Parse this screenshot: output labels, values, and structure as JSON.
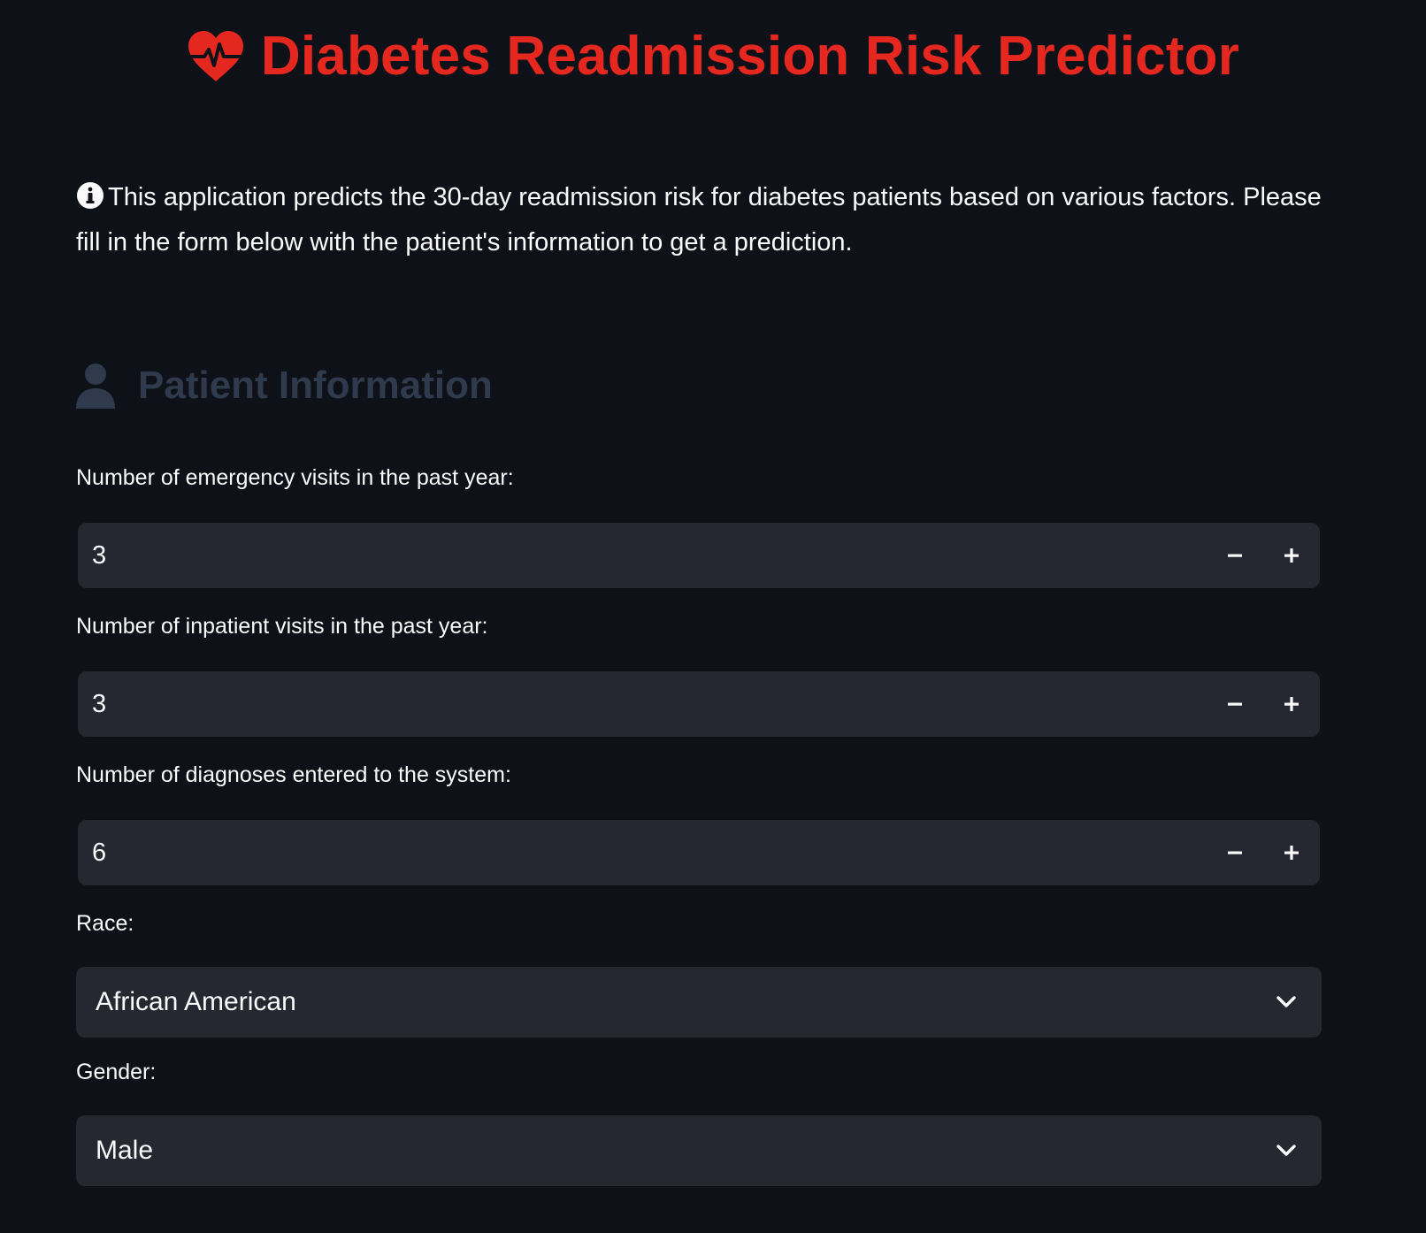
{
  "header": {
    "title": "Diabetes Readmission Risk Predictor",
    "icon": "heart-pulse-icon",
    "accent_color": "#e5281f"
  },
  "intro": {
    "icon": "info-icon",
    "text": "This application predicts the 30-day readmission risk for diabetes patients based on various factors. Please fill in the form below with the patient's information to get a prediction."
  },
  "section": {
    "icon": "person-icon",
    "title": "Patient Information"
  },
  "fields": {
    "emergency": {
      "label": "Number of emergency visits in the past year:",
      "value": "3",
      "decrement": "−",
      "increment": "+"
    },
    "inpatient": {
      "label": "Number of inpatient visits in the past year:",
      "value": "3",
      "decrement": "−",
      "increment": "+"
    },
    "diagnoses": {
      "label": "Number of diagnoses entered to the system:",
      "value": "6",
      "decrement": "−",
      "increment": "+"
    },
    "race": {
      "label": "Race:",
      "selected": "African American"
    },
    "gender": {
      "label": "Gender:",
      "selected": "Male"
    }
  },
  "colors": {
    "background": "#0e1118",
    "input_bg": "#262730",
    "text": "#fafafa",
    "section_title": "#2f3a4d"
  }
}
